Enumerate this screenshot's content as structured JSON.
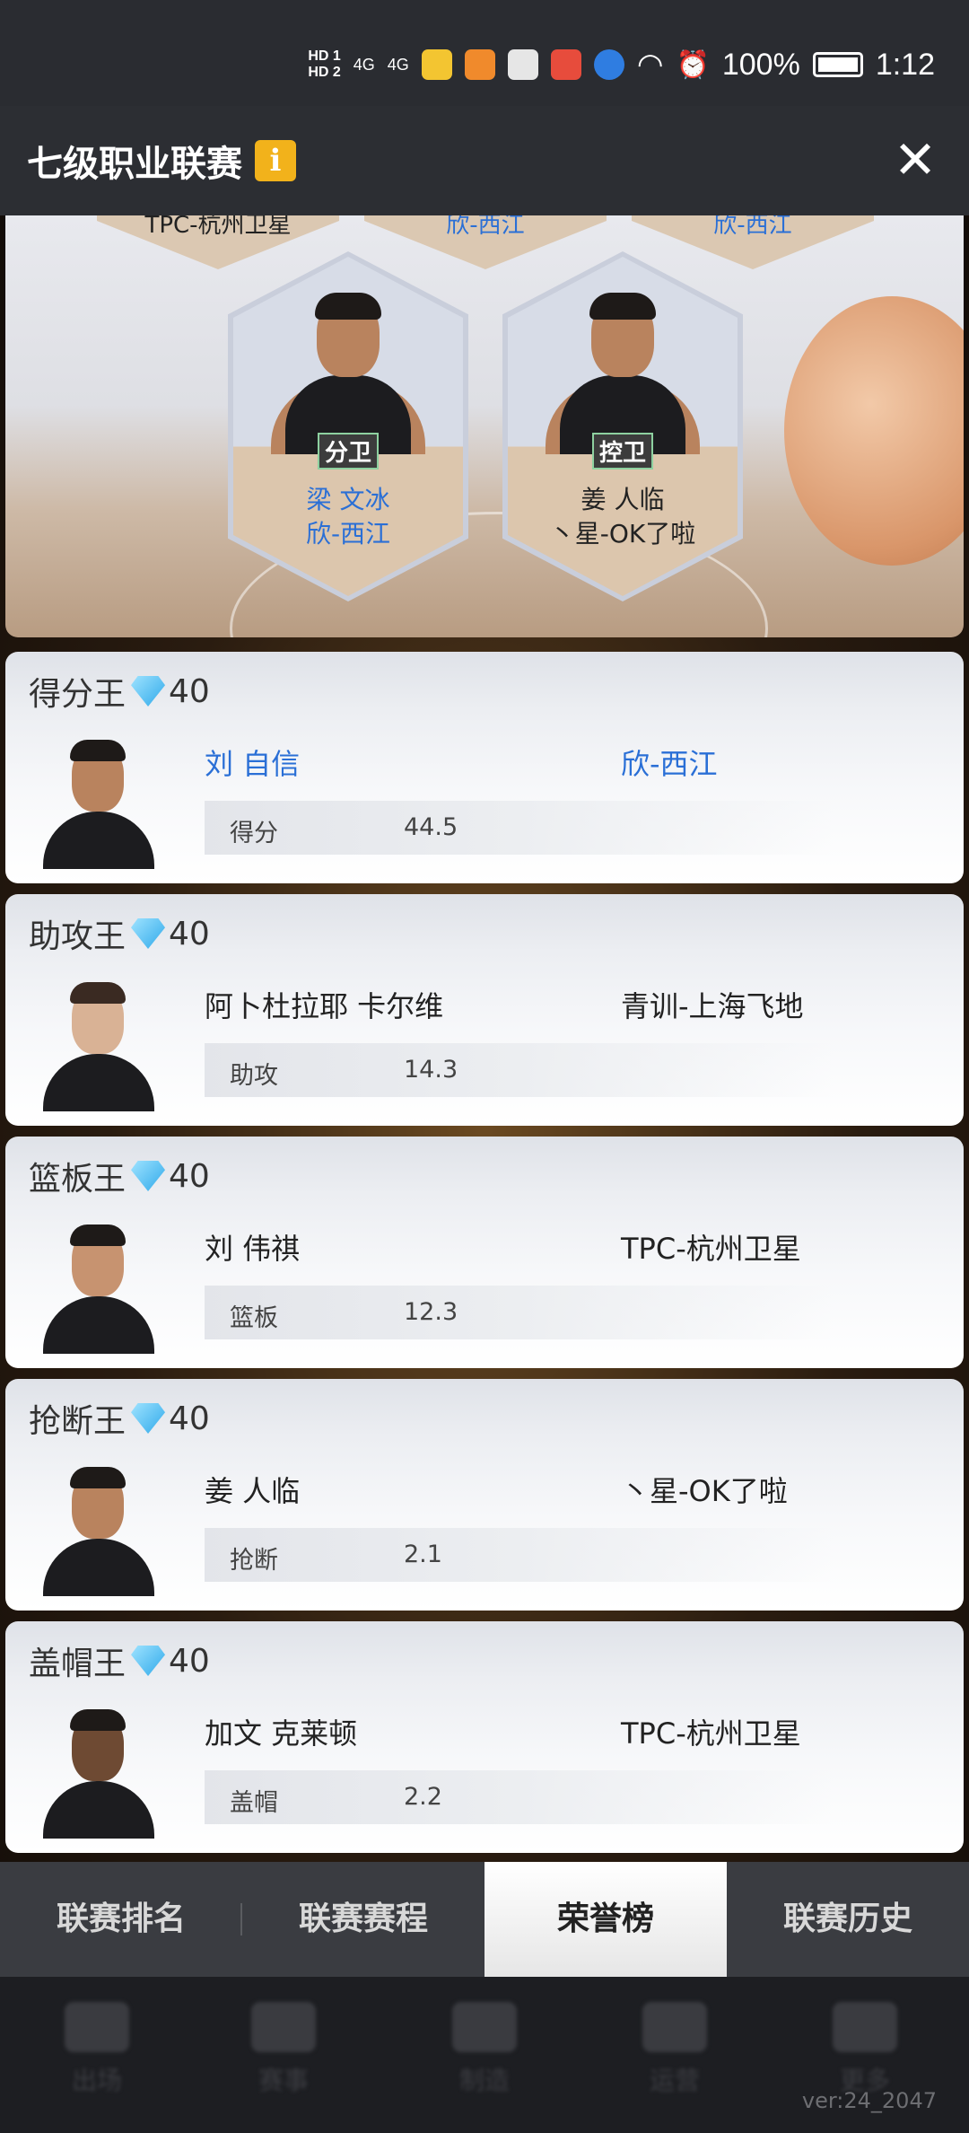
{
  "status_bar": {
    "battery": "100%",
    "time": "1:12",
    "network": [
      "HD 1",
      "HD 2",
      "4G",
      "4G"
    ]
  },
  "header": {
    "title": "七级职业联赛",
    "info_icon": "i",
    "close_icon": "✕"
  },
  "top_partial_teams": [
    "TPC-杭州卫星",
    "欣-西江",
    "欣-西江"
  ],
  "lineup": [
    {
      "position": "分卫",
      "name": "梁 文冰",
      "team": "欣-西江",
      "highlight": true
    },
    {
      "position": "控卫",
      "name": "姜 人临",
      "team": "丶星-OK了啦",
      "highlight": false
    }
  ],
  "awards": [
    {
      "title": "得分王",
      "reward": "40",
      "player": "刘 自信",
      "team": "欣-西江",
      "stat_label": "得分",
      "stat_value": "44.5",
      "highlight": true
    },
    {
      "title": "助攻王",
      "reward": "40",
      "player": "阿卜杜拉耶 卡尔维",
      "team": "青训-上海飞地",
      "stat_label": "助攻",
      "stat_value": "14.3",
      "highlight": false
    },
    {
      "title": "篮板王",
      "reward": "40",
      "player": "刘 伟祺",
      "team": "TPC-杭州卫星",
      "stat_label": "篮板",
      "stat_value": "12.3",
      "highlight": false
    },
    {
      "title": "抢断王",
      "reward": "40",
      "player": "姜 人临",
      "team": "丶星-OK了啦",
      "stat_label": "抢断",
      "stat_value": "2.1",
      "highlight": false
    },
    {
      "title": "盖帽王",
      "reward": "40",
      "player": "加文 克莱顿",
      "team": "TPC-杭州卫星",
      "stat_label": "盖帽",
      "stat_value": "2.2",
      "highlight": false
    }
  ],
  "tabs": [
    {
      "label": "联赛排名",
      "active": false
    },
    {
      "label": "联赛赛程",
      "active": false
    },
    {
      "label": "荣誉榜",
      "active": true
    },
    {
      "label": "联赛历史",
      "active": false
    }
  ],
  "bottom_nav": [
    "出场",
    "赛事",
    "制造",
    "运营",
    "更多"
  ],
  "version": "ver:24_2047",
  "colors": {
    "accent_blue": "#2a6fd6",
    "info_badge": "#f2b21b",
    "gem": "#2fa9ea"
  }
}
